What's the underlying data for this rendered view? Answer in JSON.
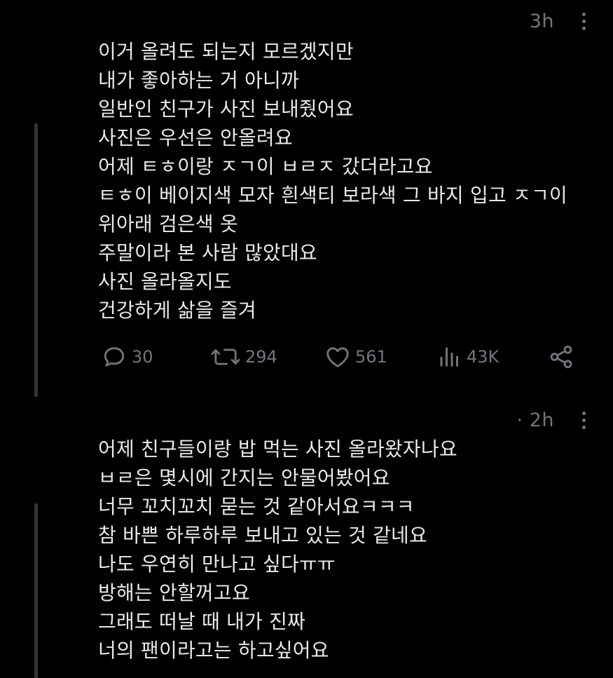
{
  "colors": {
    "background": "#000000",
    "text": "#e7e9ea",
    "muted": "#71767b",
    "thread_line": "#333639"
  },
  "post1": {
    "time": "3h",
    "lines": [
      "이거 올려도 되는지 모르겠지만",
      "내가 좋아하는 거 아니까",
      "일반인 친구가 사진 보내줬어요",
      "사진은 우선은 안올려요",
      "어제 ㅌㅎ이랑 ㅈㄱ이 ㅂㄹㅈ 갔더라고요",
      "ㅌㅎ이 베이지색 모자 흰색티 보라색 그 바지 입고 ㅈㄱ이",
      "위아래 검은색 옷",
      "주말이라 본 사람 많았대요",
      "사진 올라올지도",
      "건강하게 삶을 즐겨"
    ],
    "actions": {
      "replies": "30",
      "reposts": "294",
      "likes": "561",
      "views": "43K"
    },
    "icons": [
      "reply-icon",
      "repost-icon",
      "like-icon",
      "views-icon",
      "share-icon",
      "more-icon"
    ]
  },
  "post2": {
    "time": "· 2h",
    "lines": [
      "어제 친구들이랑 밥 먹는 사진 올라왔자나요",
      "ㅂㄹ은 몇시에 간지는 안물어봤어요",
      "너무 꼬치꼬치 묻는 것 같아서요ㅋㅋㅋ",
      "참 바쁜 하루하루 보내고 있는 것 같네요",
      "나도 우연히 만나고 싶다ㅠㅠ",
      "방해는 안할꺼고요",
      "그래도 떠날 때 내가 진짜",
      "너의 팬이라고는 하고싶어요"
    ]
  }
}
